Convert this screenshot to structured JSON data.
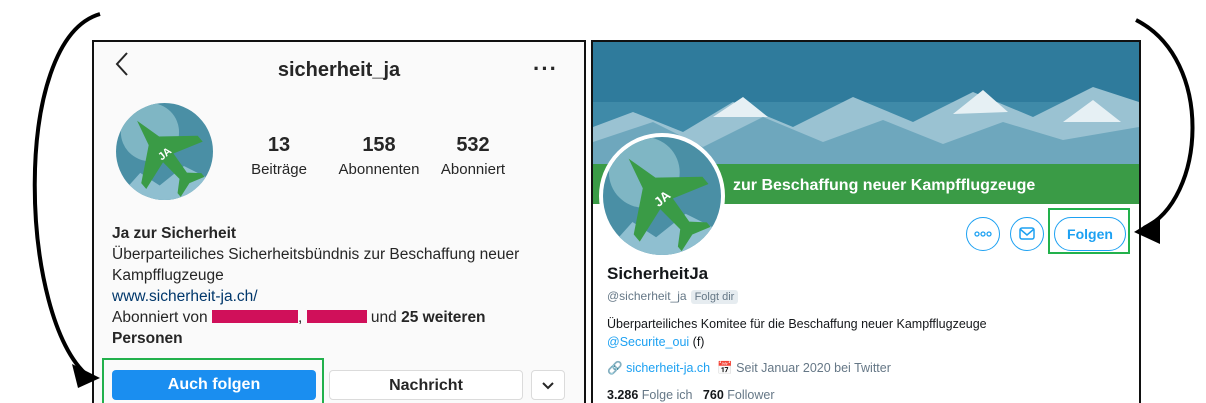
{
  "instagram": {
    "username": "sicherheit_ja",
    "stats": [
      {
        "value": "13",
        "label": "Beiträge"
      },
      {
        "value": "158",
        "label": "Abonnenten"
      },
      {
        "value": "532",
        "label": "Abonniert"
      }
    ],
    "display_name": "Ja zur Sicherheit",
    "bio": "Überparteiliches Sicherheitsbündnis zur Beschaffung neuer Kampfflugzeuge",
    "website": "www.sicherheit-ja.ch/",
    "followed_by_prefix": "Abonniert von",
    "followed_by_middle": "und",
    "followed_by_count": "25 weiteren",
    "followed_by_suffix": "Personen",
    "follow_button": "Auch folgen",
    "message_button": "Nachricht",
    "avatar_text": "JA"
  },
  "twitter": {
    "banner_text": "zur Beschaffung neuer Kampfflugzeuge",
    "name": "SicherheitJa",
    "handle": "@sicherheit_ja",
    "follows_you": "Folgt dir",
    "description": "Überparteiliches Komitee für die Beschaffung neuer Kampfflugzeuge",
    "mention": "@Securite_oui",
    "mention_suffix": "(f)",
    "website": "sicherheit-ja.ch",
    "joined": "Seit Januar 2020 bei Twitter",
    "following_count": "3.286",
    "following_label": "Folge ich",
    "followers_count": "760",
    "followers_label": "Follower",
    "follow_button": "Folgen",
    "avatar_text": "JA"
  },
  "colors": {
    "highlight": "#22b14c",
    "ig_blue": "#1a8ef0",
    "tw_blue": "#1da1f2",
    "brand_green": "#3a9b46",
    "redaction": "#d0105a"
  }
}
